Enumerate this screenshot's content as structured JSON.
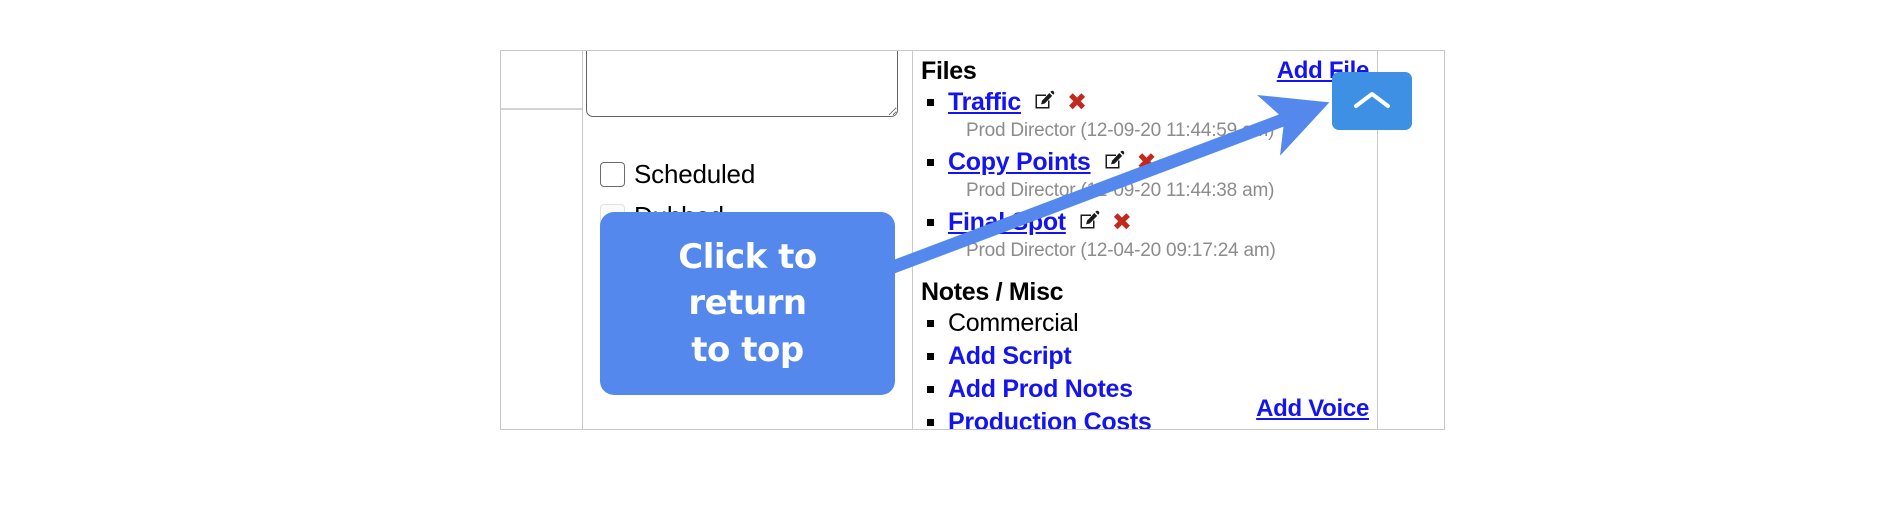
{
  "panel": {
    "form": {
      "notes_textarea_value": "",
      "notes_textarea_placeholder": "",
      "checkboxes": [
        {
          "label": "Scheduled",
          "checked": false,
          "disabled": false
        },
        {
          "label": "Dubbed",
          "checked": false,
          "disabled": true
        }
      ]
    },
    "files_section": {
      "heading": "Files",
      "add_link": "Add File",
      "items": [
        {
          "name": "Traffic",
          "meta": "Prod Director (12-09-20 11:44:59 am)"
        },
        {
          "name": "Copy Points",
          "meta": "Prod Director (12-09-20 11:44:38 am)"
        },
        {
          "name": "Final Spot",
          "meta": "Prod Director (12-04-20 09:17:24 am)"
        }
      ],
      "edit_icon": "edit-pencil-icon",
      "delete_icon": "red-x-delete-icon"
    },
    "notes_section": {
      "heading": "Notes / Misc",
      "items": [
        {
          "label": "Commercial",
          "is_link": false
        },
        {
          "label": "Add Script",
          "is_link": true
        },
        {
          "label": "Add Prod Notes",
          "is_link": true
        },
        {
          "label": "Production Costs",
          "is_link": true
        }
      ]
    },
    "add_voice_link": "Add Voice"
  },
  "scroll_to_top_button": {
    "icon": "chevron-up-icon",
    "label": ""
  },
  "annotation": {
    "tooltip_lines": [
      "Click to",
      "return",
      "to top"
    ],
    "arrow_icon": "arrow-pointing-up-right",
    "colors": {
      "tooltip_bg": "#5488EC",
      "arrow": "#5488EC",
      "button_bg": "#3D90E3",
      "link": "#1414F0",
      "delete": "#C2281E",
      "meta_text": "#8C8C8C"
    }
  }
}
